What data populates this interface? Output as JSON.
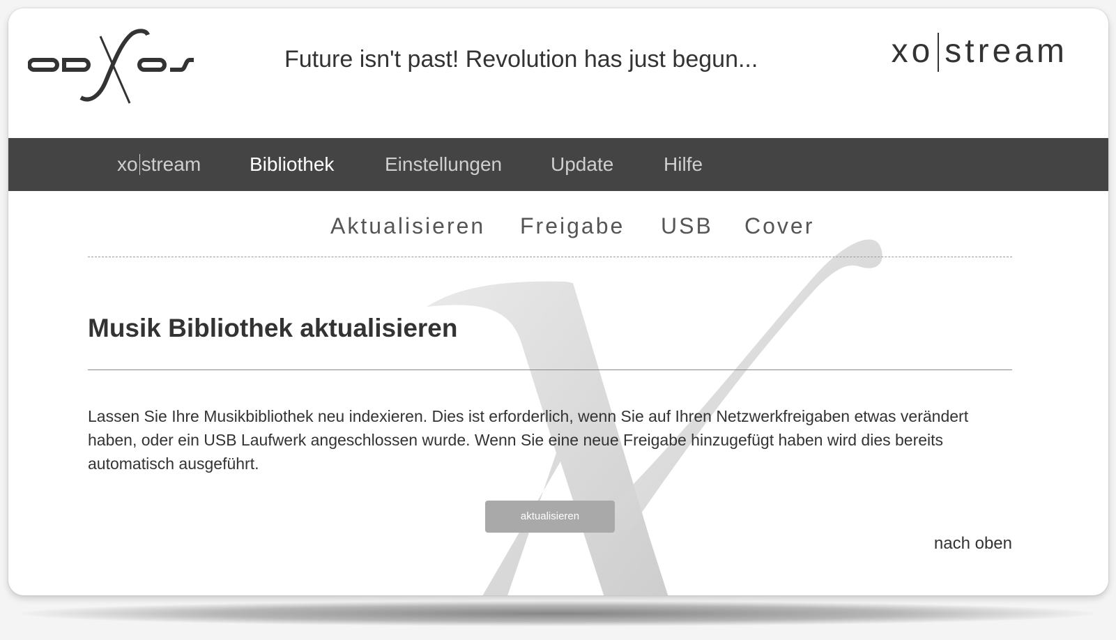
{
  "header": {
    "logo_text": "odXos",
    "tagline": "Future isn't past! Revolution has just begun...",
    "brand": {
      "left": "xo",
      "right": "stream"
    }
  },
  "nav": {
    "items": [
      {
        "left": "xo",
        "right": "stream",
        "active": false
      },
      {
        "label": "Bibliothek",
        "active": true
      },
      {
        "label": "Einstellungen",
        "active": false
      },
      {
        "label": "Update",
        "active": false
      },
      {
        "label": "Hilfe",
        "active": false
      }
    ]
  },
  "subnav": {
    "items": [
      "Aktualisieren",
      "Freigabe",
      "USB",
      "Cover"
    ]
  },
  "section": {
    "title": "Musik Bibliothek aktualisieren",
    "description": "Lassen Sie Ihre Musikbibliothek neu indexieren. Dies ist erforderlich, wenn Sie auf Ihren Netzwerkfreigaben etwas verändert haben, oder ein USB Laufwerk angeschlossen wurde. Wenn Sie eine neue Freigabe hinzugefügt haben wird dies bereits automatisch ausgeführt.",
    "button_label": "aktualisieren"
  },
  "footer": {
    "to_top": "nach oben"
  },
  "colors": {
    "nav_background": "#444444",
    "button_background": "#a9a9a9",
    "text": "#333333"
  }
}
